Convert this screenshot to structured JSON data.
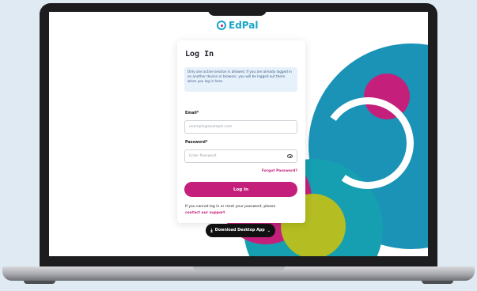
{
  "brand": {
    "name": "EdPal",
    "accent": "#c4207b",
    "teal": "#1a93b6",
    "lime": "#b4bd21"
  },
  "login": {
    "title": "Log In",
    "notice": "Only one active session is allowed. If you are already logged in on another device or browser, you will be logged out there when you log in here.",
    "email_label": "Email*",
    "email_placeholder": "example@example.com",
    "password_label": "Password*",
    "password_placeholder": "Enter Password",
    "forgot": "Forgot Password?",
    "button": "Log In",
    "help_text": "If you cannot log in or reset your password, please",
    "help_link": "contact our support"
  },
  "download": {
    "label": "Download Desktop App",
    "icon": "download-icon"
  }
}
